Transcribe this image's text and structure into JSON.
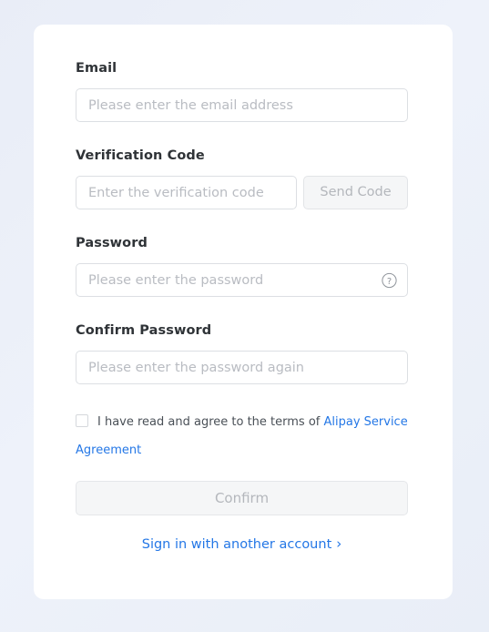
{
  "theme": {
    "page_background": "#e9edf7",
    "card_background": "#ffffff",
    "link_color": "#2477e6",
    "label_color": "#2f3337",
    "placeholder_color": "#b9bcc2",
    "disabled_bg": "#f5f6f7",
    "disabled_text": "#b4b7bc",
    "border_color": "#dcdfe3"
  },
  "form": {
    "email": {
      "label": "Email",
      "placeholder": "Please enter the email address",
      "value": ""
    },
    "verification_code": {
      "label": "Verification Code",
      "placeholder": "Enter the verification code",
      "value": "",
      "send_button": {
        "label": "Send Code",
        "disabled": true
      }
    },
    "password": {
      "label": "Password",
      "placeholder": "Please enter the password",
      "value": "",
      "help_icon": "question-circle-icon"
    },
    "confirm_password": {
      "label": "Confirm Password",
      "placeholder": "Please enter the password again",
      "value": ""
    },
    "agreement": {
      "checked": false,
      "text": "I have read and agree to the terms of ",
      "link_text": "Alipay Service Agreement"
    },
    "submit": {
      "label": "Confirm",
      "disabled": true
    },
    "alt_signin": {
      "label": "Sign in with another account",
      "chevron": "›"
    }
  }
}
